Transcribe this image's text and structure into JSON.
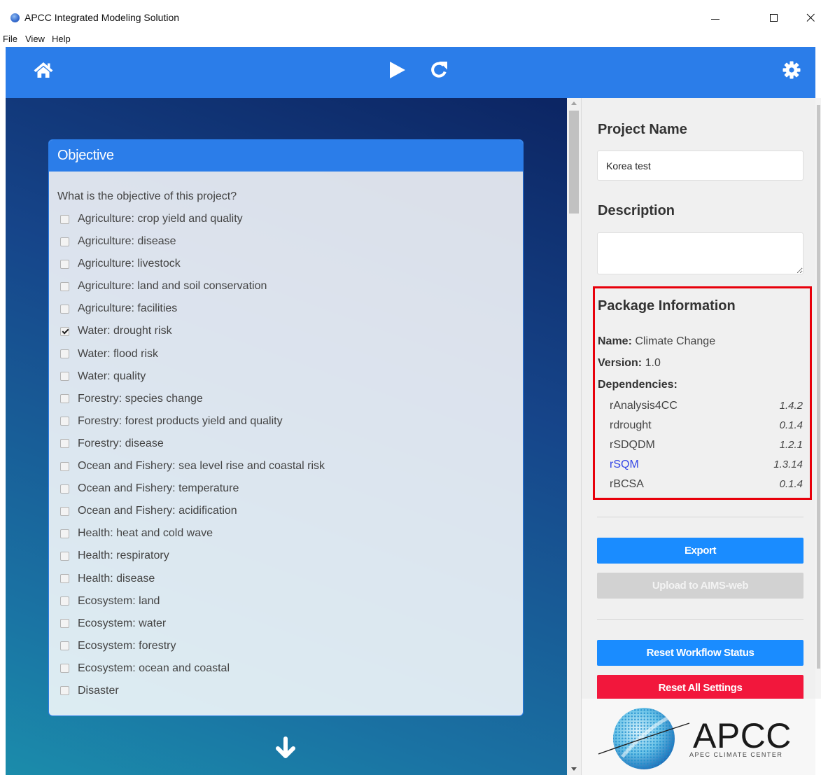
{
  "window": {
    "title": "APCC Integrated Modeling Solution",
    "app_icon": "apcc-globe-icon",
    "controls": [
      "minimize-icon",
      "maximize-icon",
      "close-icon"
    ]
  },
  "menu": {
    "file": "File",
    "view": "View",
    "help": "Help"
  },
  "toolbar": {
    "home_icon": "home-icon",
    "run_icon": "play-icon",
    "refresh_icon": "refresh-icon",
    "settings_icon": "gear-icon"
  },
  "objective": {
    "title": "Objective",
    "question": "What is the objective of this project?",
    "options": [
      {
        "label": "Agriculture: crop yield and quality",
        "checked": false
      },
      {
        "label": "Agriculture: disease",
        "checked": false
      },
      {
        "label": "Agriculture: livestock",
        "checked": false
      },
      {
        "label": "Agriculture: land and soil conservation",
        "checked": false
      },
      {
        "label": "Agriculture: facilities",
        "checked": false
      },
      {
        "label": "Water: drought risk",
        "checked": true
      },
      {
        "label": "Water: flood risk",
        "checked": false
      },
      {
        "label": "Water: quality",
        "checked": false
      },
      {
        "label": "Forestry: species change",
        "checked": false
      },
      {
        "label": "Forestry: forest products yield and quality",
        "checked": false
      },
      {
        "label": "Forestry: disease",
        "checked": false
      },
      {
        "label": "Ocean and Fishery: sea level rise and coastal risk",
        "checked": false
      },
      {
        "label": "Ocean and Fishery: temperature",
        "checked": false
      },
      {
        "label": "Ocean and Fishery: acidification",
        "checked": false
      },
      {
        "label": "Health: heat and cold wave",
        "checked": false
      },
      {
        "label": "Health: respiratory",
        "checked": false
      },
      {
        "label": "Health: disease",
        "checked": false
      },
      {
        "label": "Ecosystem: land",
        "checked": false
      },
      {
        "label": "Ecosystem: water",
        "checked": false
      },
      {
        "label": "Ecosystem: forestry",
        "checked": false
      },
      {
        "label": "Ecosystem: ocean and coastal",
        "checked": false
      },
      {
        "label": "Disaster",
        "checked": false
      }
    ],
    "next_icon": "arrow-down-icon"
  },
  "project": {
    "name_label": "Project Name",
    "name_value": "Korea test",
    "description_label": "Description",
    "description_value": ""
  },
  "package": {
    "title": "Package Information",
    "name_label": "Name:",
    "name_value": "Climate Change",
    "version_label": "Version:",
    "version_value": "1.0",
    "dependencies_label": "Dependencies:",
    "dependencies": [
      {
        "name": "rAnalysis4CC",
        "version": "1.4.2",
        "link": false
      },
      {
        "name": "rdrought",
        "version": "0.1.4",
        "link": false
      },
      {
        "name": "rSDQDM",
        "version": "1.2.1",
        "link": false
      },
      {
        "name": "rSQM",
        "version": "1.3.14",
        "link": true
      },
      {
        "name": "rBCSA",
        "version": "0.1.4",
        "link": false
      }
    ]
  },
  "actions": {
    "export": "Export",
    "upload": "Upload to AIMS-web",
    "upload_enabled": false,
    "reset_workflow": "Reset Workflow Status",
    "reset_all": "Reset All Settings"
  },
  "logo": {
    "name": "APCC",
    "subtitle": "APEC CLIMATE CENTER"
  },
  "colors": {
    "toolbar": "#2b7de9",
    "primary_button": "#1a8cff",
    "danger_button": "#f2173c",
    "disabled_button": "#d2d2d2",
    "highlight_box": "#e8000b",
    "link": "#3446e6"
  }
}
